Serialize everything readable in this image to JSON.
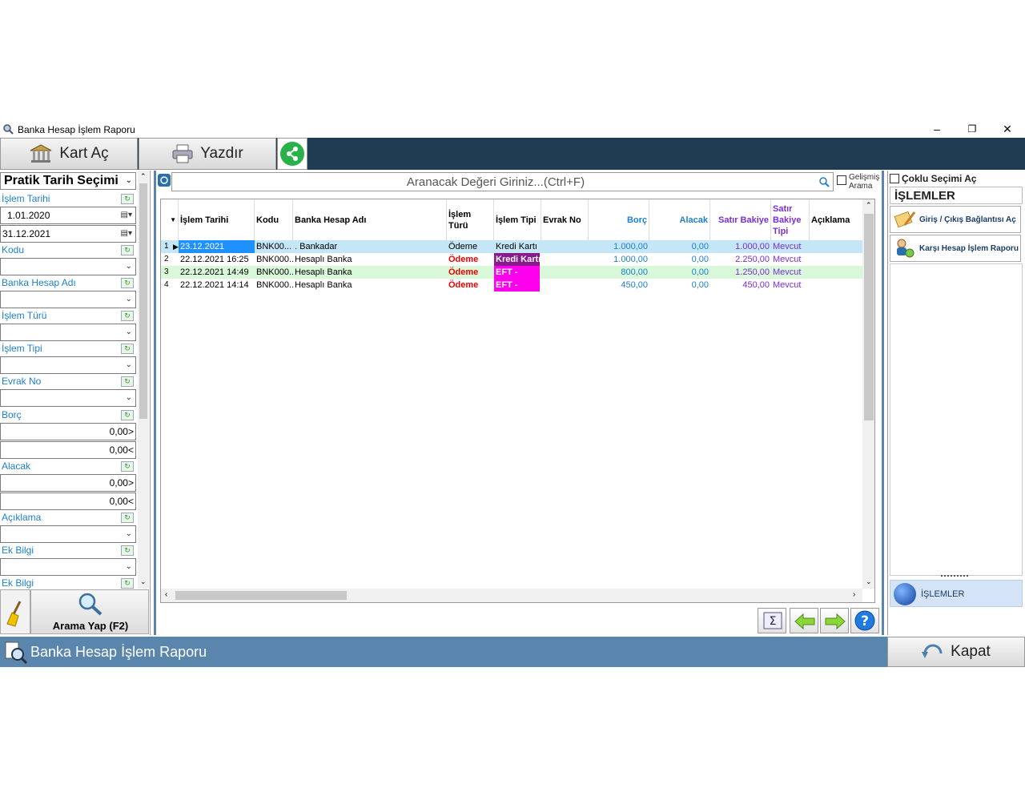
{
  "window": {
    "title": "Banka Hesap İşlem Raporu"
  },
  "toolbar": {
    "kart_ac": "Kart Aç",
    "yazdir": "Yazdır"
  },
  "left": {
    "date_select_label": "Pratik Tarih Seçimi",
    "islem_tarihi_label": "İşlem Tarihi",
    "date_from": "1.01.2020",
    "date_to": "31.12.2021",
    "kodu_label": "Kodu",
    "banka_hesap_adi_label": "Banka Hesap Adı",
    "islem_turu_label": "İşlem Türü",
    "islem_tipi_label": "İşlem Tipi",
    "evrak_no_label": "Evrak No",
    "borc_label": "Borç",
    "borc_min": "0,00>",
    "borc_max": "0,00<",
    "alacak_label": "Alacak",
    "alacak_min": "0,00>",
    "alacak_max": "0,00<",
    "aciklama_label": "Açıklama",
    "ek_bilgi_label": "Ek Bilgi",
    "ek_bilgi2_label": "Ek Bilgi",
    "search_button": "Arama Yap (F2)"
  },
  "search": {
    "placeholder": "Aranacak Değeri Giriniz...(Ctrl+F)",
    "gelismis_1": "Gelişmiş",
    "gelismis_2": "Arama"
  },
  "grid": {
    "headers": {
      "islem_tarihi": "İşlem Tarihi",
      "kodu": "Kodu",
      "banka_hesap_adi": "Banka Hesap Adı",
      "islem_turu": "İşlem Türü",
      "islem_tipi": "İşlem Tipi",
      "evrak_no": "Evrak No",
      "borc": "Borç",
      "alacak": "Alacak",
      "satir_bakiye": "Satır Bakiye",
      "satir_bakiye_tipi_1": "Satır",
      "satir_bakiye_tipi_2": "Bakiye",
      "satir_bakiye_tipi_3": "Tipi",
      "aciklama": "Açıklama"
    },
    "rows": [
      {
        "no": "1",
        "tarih": "23.12.2021",
        "kodu": "BNK00...",
        "hesap": ". Bankadar",
        "tur": "Ödeme",
        "tip": "Kredi Kartı",
        "borc": "1.000,00",
        "alacak": "0,00",
        "bakiye": "1.000,00",
        "bakiye_tipi": "Mevcut"
      },
      {
        "no": "2",
        "tarih": "22.12.2021 16:25",
        "kodu": "BNK000...",
        "hesap": "Hesaplı Banka",
        "tur": "Ödeme",
        "tip": "Kredi Kartı",
        "borc": "1.000,00",
        "alacak": "0,00",
        "bakiye": "2.250,00",
        "bakiye_tipi": "Mevcut"
      },
      {
        "no": "3",
        "tarih": "22.12.2021 14:49",
        "kodu": "BNK000...",
        "hesap": "Hesaplı Banka",
        "tur": "Ödeme",
        "tip": "EFT -",
        "borc": "800,00",
        "alacak": "0,00",
        "bakiye": "1.250,00",
        "bakiye_tipi": "Mevcut"
      },
      {
        "no": "4",
        "tarih": "22.12.2021 14:14",
        "kodu": "BNK000...",
        "hesap": "Hesaplı Banka",
        "tur": "Ödeme",
        "tip": "EFT -",
        "borc": "450,00",
        "alacak": "0,00",
        "bakiye": "450,00",
        "bakiye_tipi": "Mevcut"
      }
    ]
  },
  "right": {
    "coklu_secim": "Çoklu Seçimi Aç",
    "islemler_title": "İŞLEMLER",
    "btn_giris_cikis": "Giriş / Çıkış Bağlantısı Aç",
    "btn_karsi_hesap": "Karşı Hesap İşlem Raporu",
    "islemler_tab": "İŞLEMLER"
  },
  "status": {
    "title": "Banka Hesap İşlem Raporu",
    "kapat": "Kapat"
  },
  "colors": {
    "toolbar_bg": "#1f3c52",
    "status_bg": "#5a86ad",
    "accent_blue": "#1e7fd0",
    "row1_bg": "#c5e6f7",
    "row3_bg": "#d9f7d9",
    "kredi_karti_purple": "#8b1a8f",
    "eft_magenta": "#ff00ee"
  }
}
